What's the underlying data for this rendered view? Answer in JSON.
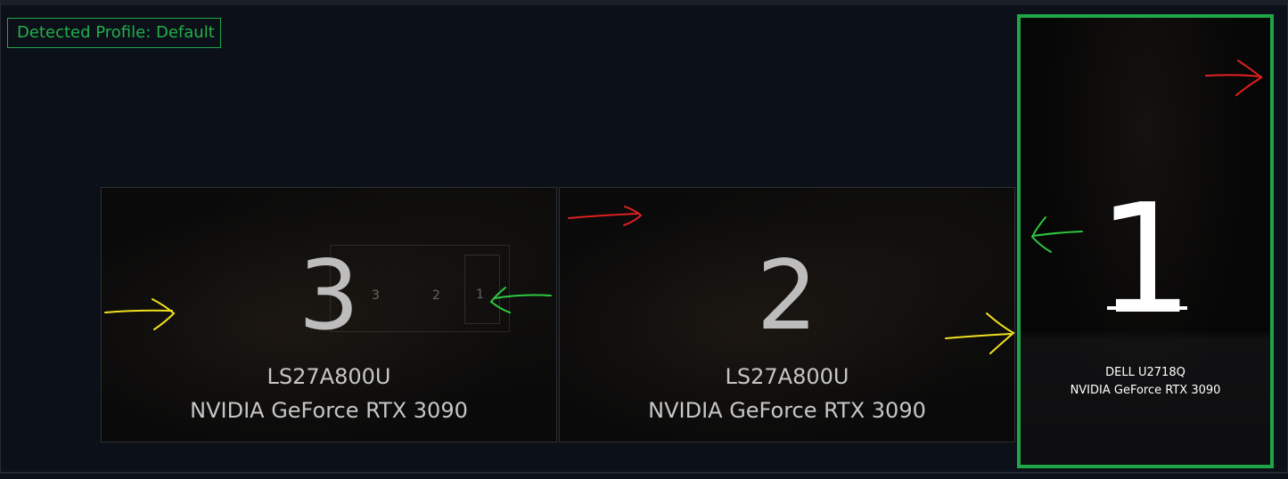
{
  "profile": {
    "label": "Detected Profile: Default"
  },
  "monitors": [
    {
      "number": "3",
      "model": "LS27A800U",
      "gpu": "NVIDIA GeForce RTX 3090",
      "preview": {
        "labels": [
          "3",
          "2",
          "1"
        ]
      }
    },
    {
      "number": "2",
      "model": "LS27A800U",
      "gpu": "NVIDIA GeForce RTX 3090"
    },
    {
      "number": "1",
      "model": "DELL U2718Q",
      "gpu": "NVIDIA GeForce RTX 3090",
      "selected": true
    }
  ],
  "colors": {
    "accent_green": "#1fa547",
    "annotation_red": "#e02020",
    "annotation_green": "#2ec840",
    "annotation_yellow": "#f0e020"
  },
  "annotations": {
    "icons": [
      "red-arrow-icon",
      "green-arrow-icon",
      "yellow-arrow-icon"
    ]
  }
}
